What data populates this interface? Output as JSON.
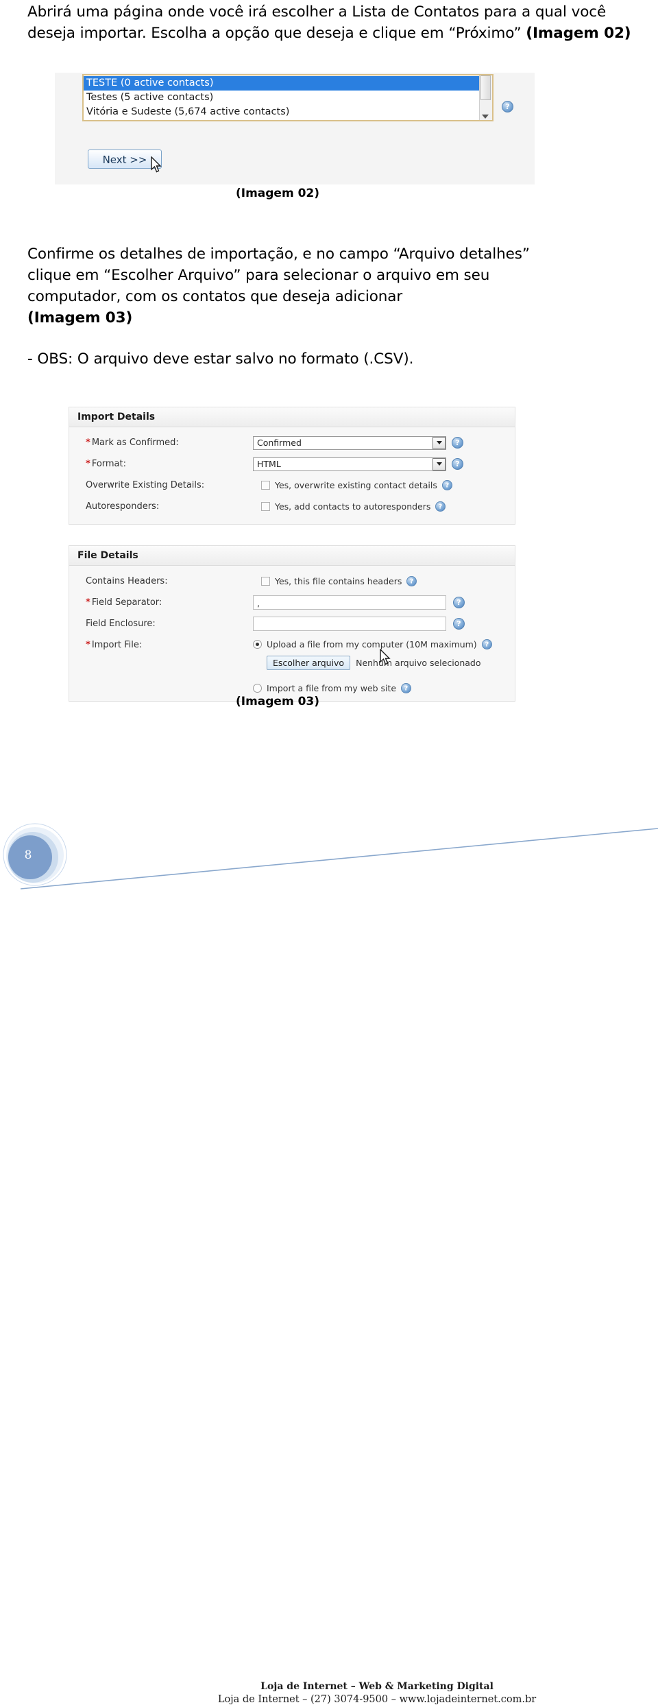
{
  "document": {
    "intro_paragraph_part1": "Abrirá uma página onde você irá escolher a Lista de Contatos para a qual você deseja importar. Escolha a opção que deseja e clique em “Próximo” ",
    "intro_paragraph_bold": "(Imagem 02)",
    "confirm_paragraph": "Confirme os detalhes de importação, e no campo “Arquivo detalhes” clique em “Escolher Arquivo” para selecionar o arquivo em seu computador, com os contatos que deseja adicionar ",
    "confirm_paragraph_bold": "(Imagem 03)",
    "obs_paragraph": "- OBS: O arquivo deve estar salvo no formato (.CSV).",
    "caption_imagem_02": "(Imagem 02)",
    "caption_imagem_03": "(Imagem 03)"
  },
  "screenshot_02": {
    "listbox": {
      "items": [
        {
          "label": "TESTE (0 active contacts)",
          "selected": true
        },
        {
          "label": "Testes (5 active contacts)",
          "selected": false
        },
        {
          "label": "Vitória e Sudeste (5,674 active contacts)",
          "selected": false
        }
      ]
    },
    "next_button_label": "Next >>",
    "help_icon": "help-icon",
    "cursor_icon": "mouse-pointer-icon"
  },
  "screenshot_03": {
    "import_details": {
      "title": "Import Details",
      "rows": [
        {
          "label": "Mark as Confirmed:",
          "required": true,
          "type": "select",
          "value": "Confirmed"
        },
        {
          "label": "Format:",
          "required": true,
          "type": "select",
          "value": "HTML"
        },
        {
          "label": "Overwrite Existing Details:",
          "required": false,
          "type": "checkbox",
          "checkbox_label": "Yes, overwrite existing contact details",
          "checked": false
        },
        {
          "label": "Autoresponders:",
          "required": false,
          "type": "checkbox",
          "checkbox_label": "Yes, add contacts to autoresponders",
          "checked": false
        }
      ]
    },
    "file_details": {
      "title": "File Details",
      "rows": [
        {
          "label": "Contains Headers:",
          "required": false,
          "type": "checkbox",
          "checkbox_label": "Yes, this file contains headers",
          "checked": false
        },
        {
          "label": "Field Separator:",
          "required": true,
          "type": "text",
          "value": ","
        },
        {
          "label": "Field Enclosure:",
          "required": false,
          "type": "text",
          "value": ""
        }
      ],
      "import_file": {
        "label": "Import File:",
        "required": true,
        "option_upload": "Upload a file from my computer (10M maximum)",
        "option_upload_selected": true,
        "file_button_label": "Escolher arquivo",
        "file_status_label": "Nenhum arquivo selecionado",
        "option_website": "Import a file from my web site",
        "option_website_selected": false
      }
    },
    "cursor_icon": "mouse-pointer-icon"
  },
  "footer": {
    "page_number": "8",
    "line1": "Loja de Internet – Web & Marketing Digital",
    "line2": "Loja de Internet – (27) 3074-9500 – www.lojadeinternet.com.br"
  },
  "colors": {
    "list_selection": "#2a7fe0",
    "listbox_border": "#d9c08a",
    "footer_accent": "#7d9ecb",
    "required_asterisk": "#cc2222"
  }
}
